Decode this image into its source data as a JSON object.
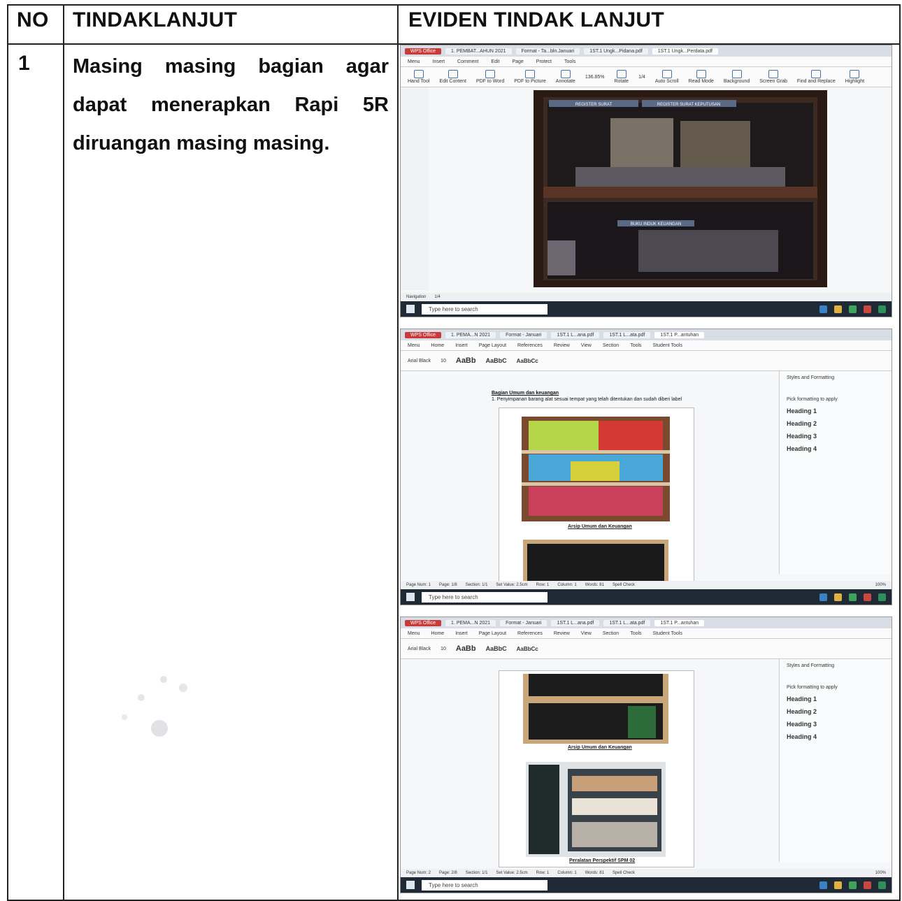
{
  "table": {
    "headers": {
      "no": "NO",
      "action": "TINDAKLANJUT",
      "evidence": "EVIDEN TINDAK LANJUT"
    },
    "rows": [
      {
        "no": "1",
        "action": "Masing masing bagian agar dapat menerapkan Rapi 5R diruangan masing masing."
      }
    ]
  },
  "screenshots": [
    {
      "tabs": [
        "WPS Office",
        "1. PEMBAT...AHUN 2021",
        "Format - Ta...bln.Januari",
        "1ST.1 Ungk...Pidana.pdf",
        "1ST.1 Ungk...Perdata.pdf"
      ],
      "menu": [
        "Menu",
        "Insert",
        "Comment",
        "Edit",
        "Page",
        "Protect",
        "Tools"
      ],
      "tools": [
        "Hand Tool",
        "Edit Content",
        "PDF to Word",
        "PDF to Picture",
        "Annotate",
        "Rotate",
        "Auto Scroll",
        "Read Mode",
        "Background",
        "Screen Grab",
        "Find and Replace",
        "Highlight"
      ],
      "zoom": "136.85%",
      "page_counter": "1/4",
      "sign_top_left": "REGISTER SURAT",
      "sign_top_right": "REGISTER SURAT KEPUTUSAN",
      "sign_middle": "BUKU INDUK KEUANGAN",
      "nav_label": "Navigation",
      "search_placeholder": "Type here to search"
    },
    {
      "tabs": [
        "WPS Office",
        "1. PEMA...N 2021",
        "Format - Januari",
        "1ST.1 L...ana.pdf",
        "1ST.1 L...ata.pdf",
        "1ST.1 P...antuhan"
      ],
      "menu": [
        "Menu",
        "Home",
        "Insert",
        "Page Layout",
        "References",
        "Review",
        "View",
        "Section",
        "Tools",
        "Student Tools"
      ],
      "font_name": "Arial Black",
      "font_size": "10",
      "styles": [
        "AaBb",
        "AaBbC",
        "AaBbCc"
      ],
      "doc_heading": "Bagian Umum dan keuangan",
      "doc_line": "1. Penyimpanan barang alat sesuai tempat yang telah ditentukan dan sudah diberi label",
      "caption": "Arsip Umum dan Keuangan",
      "pane_title": "Styles and Formatting",
      "pane_items": [
        "Heading 1",
        "Heading 2",
        "Heading 3",
        "Heading 4"
      ],
      "pane_label": "Pick formatting to apply",
      "status": [
        "Page Num: 1",
        "Page: 1/8",
        "Section: 1/1",
        "Set Value: 2.5cm",
        "Row: 1",
        "Column: 1",
        "Words: 81",
        "Spell Check"
      ],
      "zoom": "100%",
      "search_placeholder": "Type here to search"
    },
    {
      "tabs": [
        "WPS Office",
        "1. PEMA...N 2021",
        "Format - Januari",
        "1ST.1 L...ana.pdf",
        "1ST.1 L...ata.pdf",
        "1ST.1 P...antuhan"
      ],
      "menu": [
        "Menu",
        "Home",
        "Insert",
        "Page Layout",
        "References",
        "Review",
        "View",
        "Section",
        "Tools",
        "Student Tools"
      ],
      "font_name": "Arial Black",
      "font_size": "10",
      "styles": [
        "AaBb",
        "AaBbC",
        "AaBbCc"
      ],
      "caption_top": "Arsip Umum dan Keuangan",
      "caption_bottom": "Peralatan Perspektif SPM 02",
      "pane_title": "Styles and Formatting",
      "pane_items": [
        "Heading 1",
        "Heading 2",
        "Heading 3",
        "Heading 4"
      ],
      "pane_label": "Pick formatting to apply",
      "status": [
        "Page Num: 2",
        "Page: 2/8",
        "Section: 1/1",
        "Set Value: 2.5cm",
        "Row: 1",
        "Column: 1",
        "Words: 81",
        "Spell Check"
      ],
      "zoom": "100%",
      "search_placeholder": "Type here to search"
    }
  ]
}
